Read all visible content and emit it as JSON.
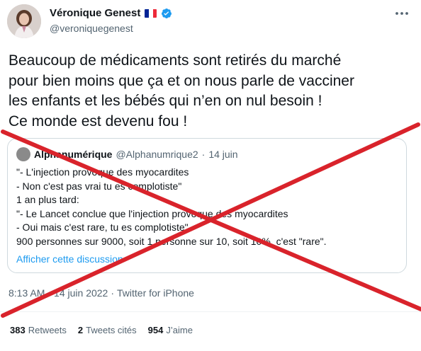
{
  "author": {
    "name": "Véronique Genest",
    "handle": "@veroniquegenest",
    "flag_colors": [
      "#002395",
      "#ffffff",
      "#ed2939"
    ],
    "verified_color": "#1d9bf0"
  },
  "tweet": {
    "text": "Beaucoup de médicaments sont retirés du marché\npour bien moins que ça et on nous parle de vacciner\nles enfants et les bébés qui n’en on nul besoin !\nCe monde est devenu fou !",
    "time": "8:13 AM",
    "date": "14 juin 2022",
    "source": "Twitter for iPhone"
  },
  "quoted": {
    "name": "Alphanumérique",
    "handle": "@Alphanumrique2",
    "date": "14 juin",
    "lines": [
      "\"- L'injection provoque des myocardites",
      "- Non c'est pas vrai tu es complotiste\"",
      "1 an plus tard:",
      "\"- Le Lancet conclue que l'injection provoque des myocardites",
      "- Oui mais c'est rare, tu es complotiste\"",
      "900 personnes sur 9000, soit 1 personne sur 10, soit 10%, c'est \"rare\"."
    ],
    "show_thread": "Afficher cette discussion"
  },
  "stats": {
    "retweets_count": "383",
    "retweets_label": "Retweets",
    "quotes_count": "2",
    "quotes_label": "Tweets cités",
    "likes_count": "954",
    "likes_label": "J’aime"
  },
  "overlay": {
    "cross_color": "#d9232b"
  },
  "icons": {
    "more": "more-horizontal-icon",
    "verified": "verified-badge-icon"
  }
}
